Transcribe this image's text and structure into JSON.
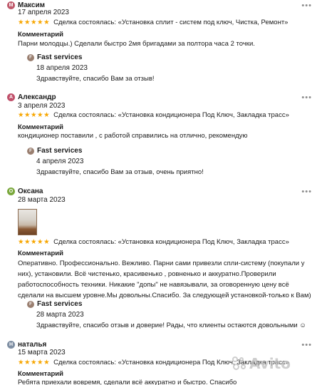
{
  "colors": {
    "star": "#f7a600",
    "avatar_m": "#c05a6c",
    "avatar_a": "#c0506a",
    "avatar_o": "#7aa83c",
    "avatar_n": "#7f8fa3",
    "reply_avatar": "#9a7f70"
  },
  "reviews": [
    {
      "avatar_letter": "M",
      "name": "Максим",
      "date": "17 апреля 2023",
      "stars": "★★★★★",
      "deal": "Сделка состоялась: «Установка сплит - систем под ключ, Чистка, Ремонт»",
      "comment_label": "Комментарий",
      "comment": "Парни молодцы.) Сделали быстро 2мя бригадами за полтора часа 2 точки.",
      "reply": {
        "avatar_letter": "F",
        "name": "Fast services",
        "date": "18 апреля 2023",
        "text": "Здравствуйте, спасибо Вам за отзыв!"
      }
    },
    {
      "avatar_letter": "A",
      "name": "Александр",
      "date": "3 апреля 2023",
      "stars": "★★★★★",
      "deal": "Сделка состоялась: «Установка кондиционера Под Ключ, Закладка трасс»",
      "comment_label": "Комментарий",
      "comment": "кондиционер поставили , с работой справились на отлично, рекомендую",
      "reply": {
        "avatar_letter": "F",
        "name": "Fast services",
        "date": "4 апреля 2023",
        "text": "Здравствуйте, спасибо Вам за отзыв, очень приятно!"
      }
    },
    {
      "avatar_letter": "O",
      "name": "Оксана",
      "date": "28 марта 2023",
      "stars": "★★★★★",
      "deal": "Сделка состоялась: «Установка кондиционера Под Ключ, Закладка трасс»",
      "comment_label": "Комментарий",
      "comment_lines": [
        "Оперативно. Профессионально. Вежливо. Парни сами привезли спли-систему (покупали у",
        "них), установили. Всё чистенько, красивенько , ровненько и аккуратно.Проверили",
        "работоспособность техники. Никакие \"допы\" не навязывали, за оговоренную цену всё",
        "сделали на высшем уровне.Мы довольны.Спасибо. За следующей установкой-только к Вам)"
      ],
      "reply": {
        "avatar_letter": "F",
        "name": "Fast services",
        "date": "28 марта 2023",
        "text": "Здравствуйте, спасибо отзыв и доверие! Рады, что клиенты остаются довольными ☺"
      }
    },
    {
      "avatar_letter": "Н",
      "name": "наталья",
      "date": "15 марта 2023",
      "stars": "★★★★★",
      "deal": "Сделка состоялась: «Установка кондиционера Под Ключ, Закладка трасс»",
      "comment_label": "Комментарий",
      "comment": "Ребята приехали вовремя, сделали всё аккуратно и быстро. Спасибо"
    }
  ],
  "watermark": {
    "text": "Avito"
  }
}
